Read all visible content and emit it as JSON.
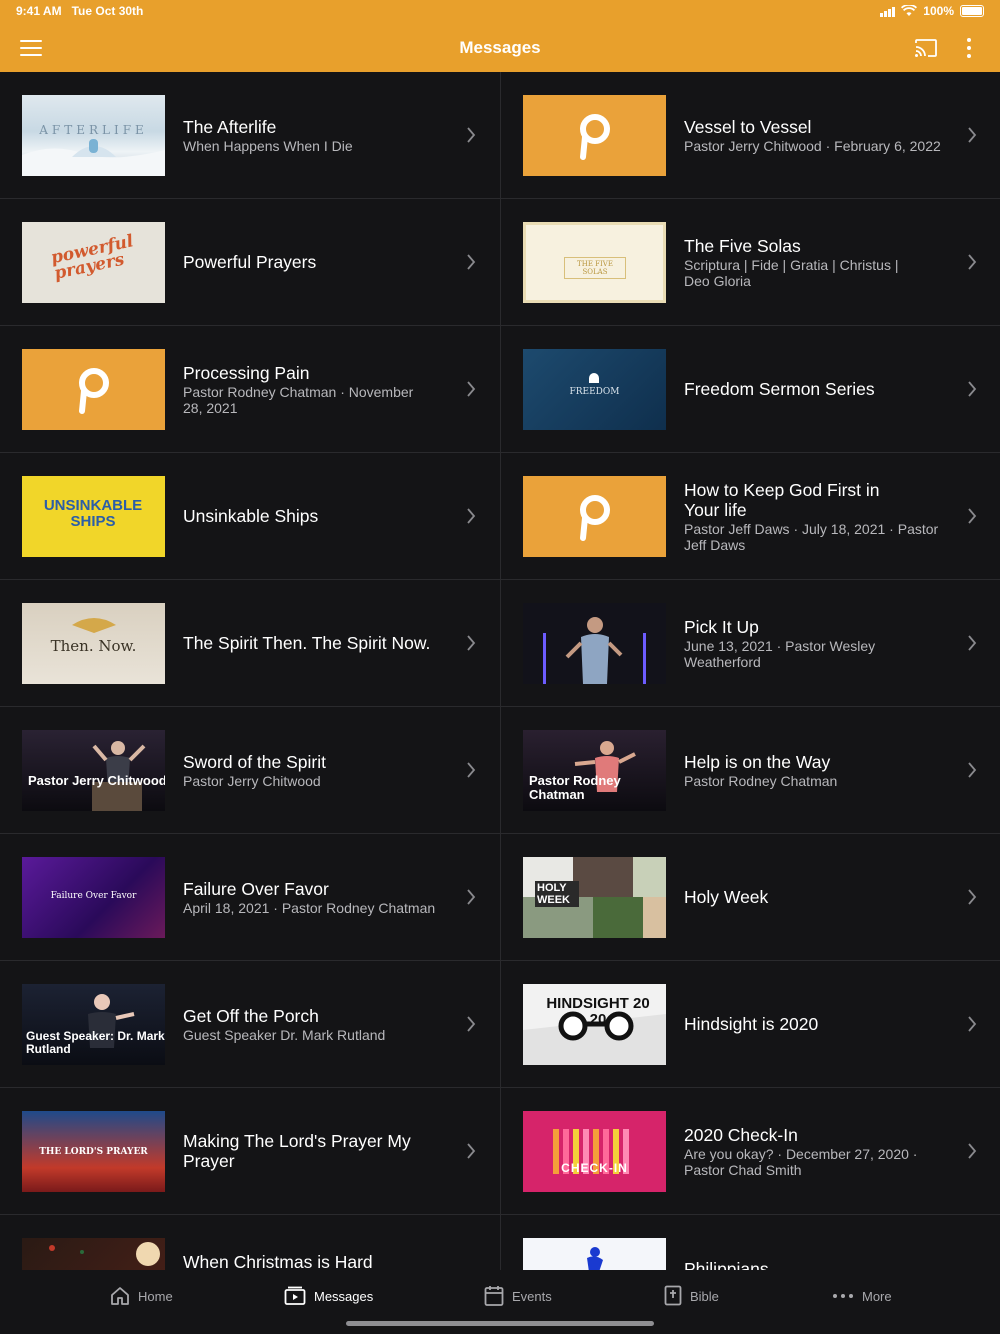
{
  "status": {
    "time": "9:41 AM",
    "date": "Tue Oct 30th",
    "battery": "100%"
  },
  "header": {
    "title": "Messages"
  },
  "colors": {
    "accent": "#E8A02C",
    "background": "#141416",
    "subtitle": "#b8b8bc"
  },
  "messages": [
    {
      "title": "The Afterlife",
      "subtitle": "When Happens When I Die",
      "thumb_text": "AFTERLIFE",
      "thumb": "afterlife"
    },
    {
      "title": "Vessel to Vessel",
      "subtitle": "Pastor Jerry Chitwood · February 6, 2022",
      "thumb_text": "",
      "thumb": "logo"
    },
    {
      "title": "Powerful Prayers",
      "subtitle": "",
      "thumb_text": "powerful prayers",
      "thumb": "powerful"
    },
    {
      "title": "The Five Solas",
      "subtitle": "Scriptura | Fide | Gratia | Christus | Deo Gloria",
      "thumb_text": "THE FIVE SOLAS",
      "thumb": "solas"
    },
    {
      "title": "Processing Pain",
      "subtitle": "Pastor Rodney Chatman · November 28, 2021",
      "thumb_text": "",
      "thumb": "logo"
    },
    {
      "title": "Freedom Sermon Series",
      "subtitle": "",
      "thumb_text": "FREEDOM",
      "thumb": "freedom"
    },
    {
      "title": "Unsinkable Ships",
      "subtitle": "",
      "thumb_text": "UNSINKABLE SHIPS",
      "thumb": "unsinkable"
    },
    {
      "title": "How to Keep God First in Your life",
      "subtitle": "Pastor Jeff Daws · July 18, 2021 · Pastor Jeff Daws",
      "thumb_text": "",
      "thumb": "logo"
    },
    {
      "title": "The Spirit Then. The Spirit Now.",
      "subtitle": "",
      "thumb_text": "Then. Now.",
      "thumb": "spirit"
    },
    {
      "title": "Pick It Up",
      "subtitle": "June 13, 2021 · Pastor Wesley Weatherford",
      "thumb_text": "",
      "thumb": "stage"
    },
    {
      "title": "Sword of the Spirit",
      "subtitle": "Pastor Jerry Chitwood",
      "thumb_text": "Pastor Jerry Chitwood",
      "thumb": "speaker"
    },
    {
      "title": "Help is on the Way",
      "subtitle": "Pastor Rodney Chatman",
      "thumb_text": "Pastor Rodney Chatman",
      "thumb": "speaker2"
    },
    {
      "title": "Failure Over Favor",
      "subtitle": "April 18, 2021 · Pastor Rodney Chatman",
      "thumb_text": "Failure Over Favor",
      "thumb": "failure"
    },
    {
      "title": "Holy Week",
      "subtitle": "",
      "thumb_text": "HOLY WEEK",
      "thumb": "holyweek"
    },
    {
      "title": "Get Off the Porch",
      "subtitle": "Guest Speaker Dr. Mark Rutland",
      "thumb_text": "Guest Speaker: Dr. Mark Rutland",
      "thumb": "speaker3"
    },
    {
      "title": "Hindsight is 2020",
      "subtitle": "",
      "thumb_text": "HINDSIGHT 20 20",
      "thumb": "hindsight"
    },
    {
      "title": "Making The Lord's Prayer My Prayer",
      "subtitle": "",
      "thumb_text": "THE LORD'S PRAYER",
      "thumb": "lordsprayer"
    },
    {
      "title": "2020 Check-In",
      "subtitle": "Are you okay? · December 27, 2020 · Pastor Chad Smith",
      "thumb_text": "CHECK-IN",
      "thumb": "checkin"
    },
    {
      "title": "When Christmas is Hard",
      "subtitle": "",
      "thumb_text": "",
      "thumb": "christmas"
    },
    {
      "title": "Philippians",
      "subtitle": "",
      "thumb_text": "",
      "thumb": "philippians"
    }
  ],
  "tabs": [
    {
      "label": "Home",
      "icon": "home-icon",
      "active": false
    },
    {
      "label": "Messages",
      "icon": "play-icon",
      "active": true
    },
    {
      "label": "Events",
      "icon": "calendar-icon",
      "active": false
    },
    {
      "label": "Bible",
      "icon": "bible-icon",
      "active": false
    },
    {
      "label": "More",
      "icon": "more-dots-icon",
      "active": false
    }
  ]
}
